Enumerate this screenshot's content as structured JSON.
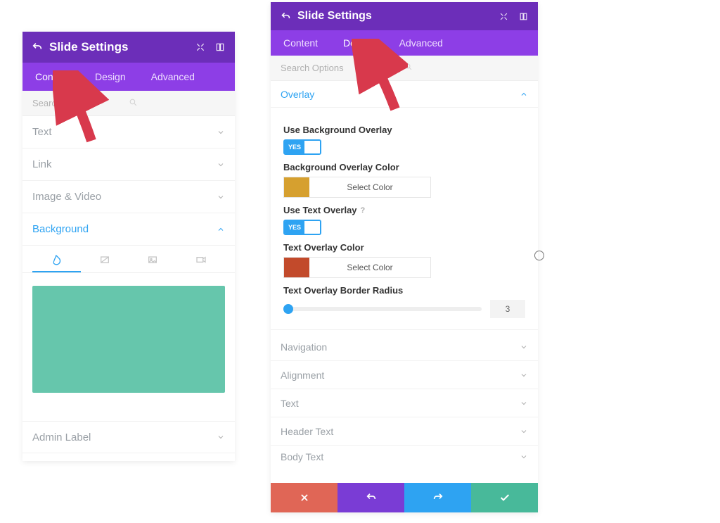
{
  "left": {
    "title": "Slide Settings",
    "tabs": {
      "content": "Content",
      "design": "Design",
      "advanced": "Advanced",
      "active": "content"
    },
    "search_placeholder": "Search Options",
    "sections": {
      "text": "Text",
      "link": "Link",
      "image_video": "Image & Video",
      "background": "Background",
      "admin_label": "Admin Label"
    },
    "bg_swatch_color": "#66c6ac"
  },
  "right": {
    "title": "Slide Settings",
    "tabs": {
      "content": "Content",
      "design": "Design",
      "advanced": "Advanced",
      "active": "design"
    },
    "search_placeholder": "Search Options",
    "overlay": {
      "section_label": "Overlay",
      "use_bg_label": "Use Background Overlay",
      "use_bg_value": "YES",
      "bg_color_label": "Background Overlay Color",
      "bg_color_value": "#d6a02f",
      "select_color": "Select Color",
      "use_text_label": "Use Text Overlay",
      "use_text_value": "YES",
      "text_color_label": "Text Overlay Color",
      "text_color_value": "#c24a2b",
      "radius_label": "Text Overlay Border Radius",
      "radius_value": "3"
    },
    "sections": {
      "navigation": "Navigation",
      "alignment": "Alignment",
      "text": "Text",
      "header_text": "Header Text",
      "body_text": "Body Text"
    }
  },
  "colors": {
    "header": "#6c2eb9",
    "tabbar": "#8d3ee6",
    "accent": "#2ea3f2",
    "footer_close": "#e06656",
    "footer_undo": "#7a3cd5",
    "footer_redo": "#2ea3f2",
    "footer_save": "#48b99a",
    "annotation_arrow": "#d8394c"
  }
}
